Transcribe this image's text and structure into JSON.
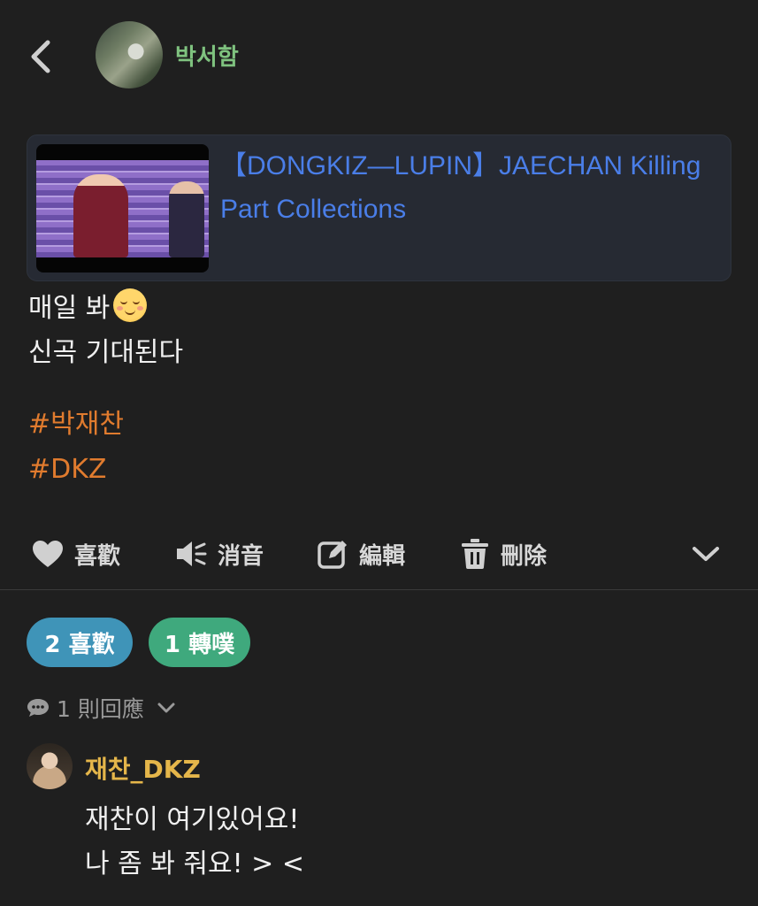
{
  "header": {
    "back_label": "back",
    "user_name": "박서함"
  },
  "link_preview": {
    "title": "【DONGKIZ—LUPIN】JAECHAN Killing Part Collections"
  },
  "post": {
    "lines": [
      "매일 봐",
      "신곡 기대된다"
    ],
    "tags": [
      "#박재찬",
      "#DKZ"
    ]
  },
  "actions": {
    "like": "喜歡",
    "mute": "消音",
    "edit": "編輯",
    "delete": "刪除"
  },
  "pills": {
    "likes": "2 喜歡",
    "replurks": "1 轉噗"
  },
  "replies": {
    "toggle_label": "1 則回應"
  },
  "response": {
    "name": "재찬_DKZ",
    "lines": [
      "재찬이 여기있어요!",
      "나 좀 봐 줘요! > <"
    ]
  },
  "colors": {
    "background": "#1f1f1f",
    "username_green": "#7fc27f",
    "link_blue": "#4a7ee8",
    "tag_orange": "#e07b2e",
    "likes_pill": "#3f94b8",
    "replurks_pill": "#3fa97d",
    "responder_gold": "#e5b64a"
  },
  "icons": [
    "chevron-left-icon",
    "heart-icon",
    "speaker-mute-icon",
    "edit-icon",
    "trash-icon",
    "chevron-down-icon",
    "comment-bubble-icon"
  ]
}
